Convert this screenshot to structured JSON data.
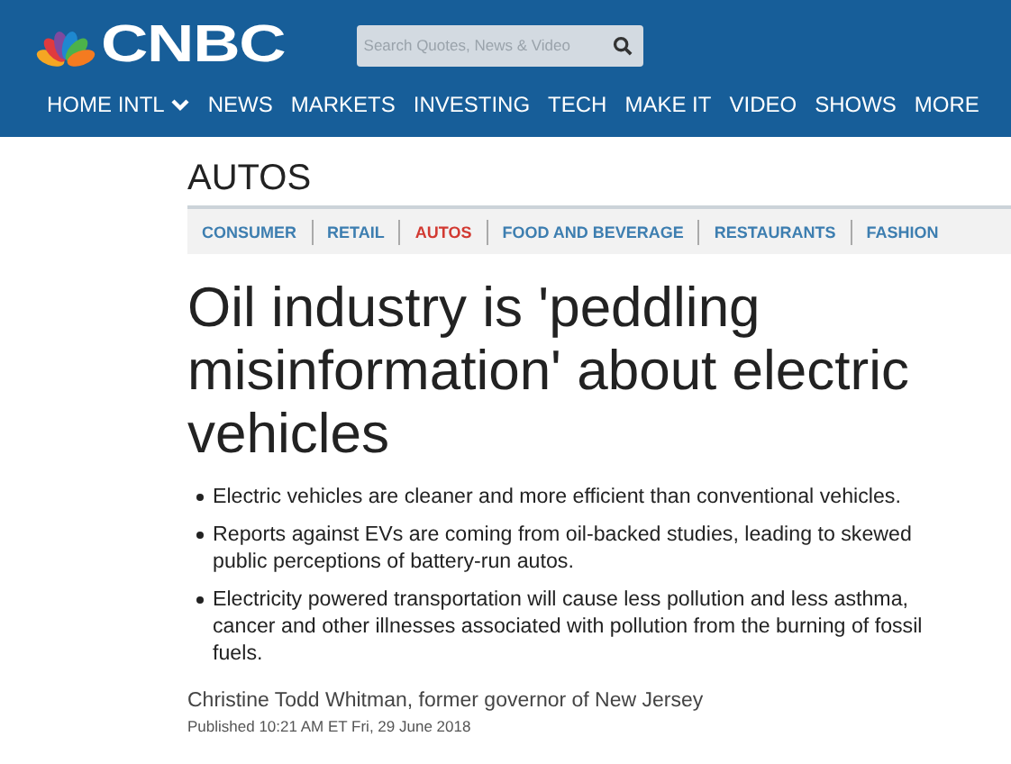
{
  "header": {
    "logo": "CNBC",
    "search": {
      "placeholder": "Search Quotes, News & Video"
    }
  },
  "nav": [
    {
      "label": "HOME INTL",
      "dropdown": true
    },
    {
      "label": "NEWS",
      "dropdown": false
    },
    {
      "label": "MARKETS",
      "dropdown": false
    },
    {
      "label": "INVESTING",
      "dropdown": false
    },
    {
      "label": "TECH",
      "dropdown": false
    },
    {
      "label": "MAKE IT",
      "dropdown": false
    },
    {
      "label": "VIDEO",
      "dropdown": false
    },
    {
      "label": "SHOWS",
      "dropdown": false
    },
    {
      "label": "MORE",
      "dropdown": false
    }
  ],
  "section": "AUTOS",
  "subnav": [
    {
      "label": "CONSUMER",
      "selected": false
    },
    {
      "label": "RETAIL",
      "selected": false
    },
    {
      "label": "AUTOS",
      "selected": true
    },
    {
      "label": "FOOD AND BEVERAGE",
      "selected": false
    },
    {
      "label": "RESTAURANTS",
      "selected": false
    },
    {
      "label": "FASHION",
      "selected": false
    }
  ],
  "article": {
    "headline": "Oil industry is 'peddling misinformation' about electric vehicles",
    "bullets": [
      "Electric vehicles are cleaner and more efficient than conventional vehicles.",
      "Reports against EVs are coming from oil-backed studies, leading to skewed public perceptions of battery-run autos.",
      "Electricity powered transportation will cause less pollution and less asthma, cancer and other illnesses associated with pollution from the burning of fossil fuels."
    ],
    "byline": "Christine Todd Whitman, former governor of New Jersey",
    "published": "Published 10:21 AM ET Fri, 29 June 2018"
  }
}
